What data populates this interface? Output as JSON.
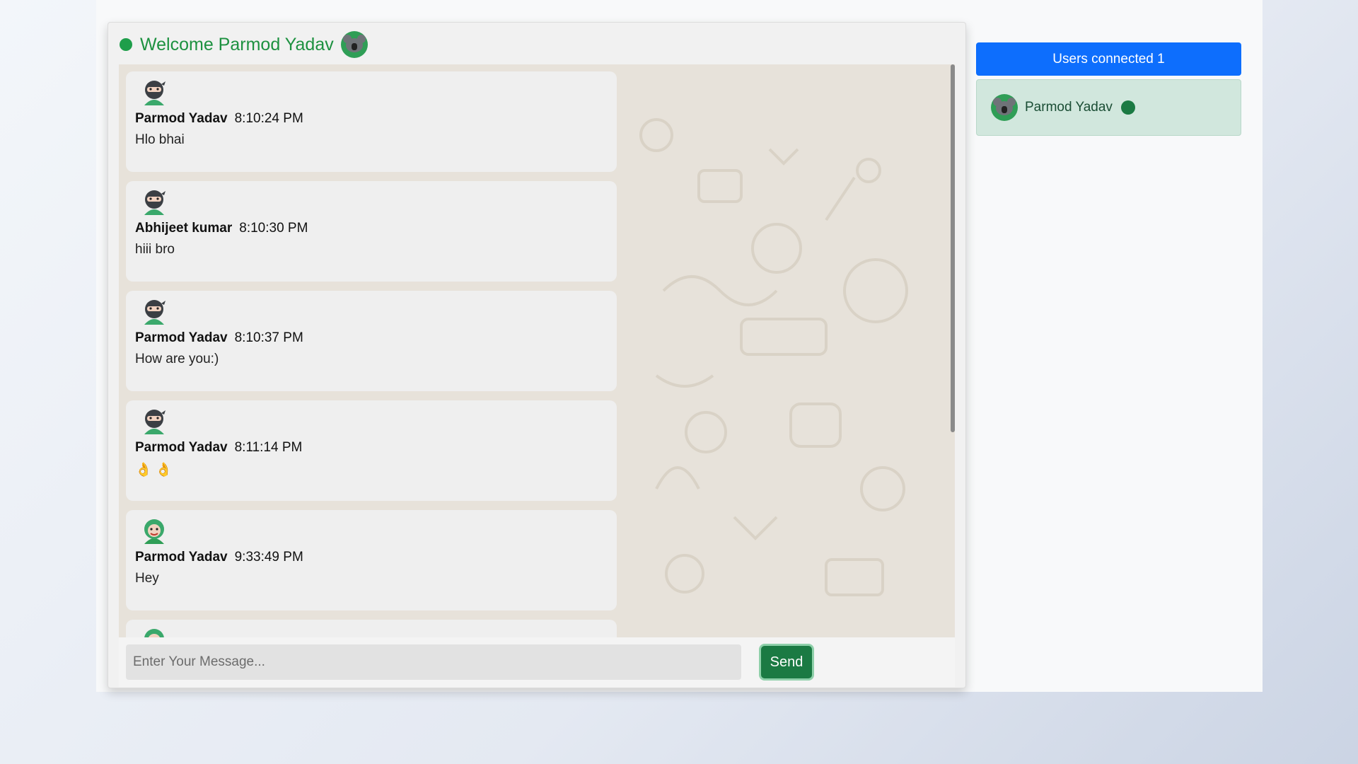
{
  "header": {
    "welcome_text": "Welcome Parmod Yadav"
  },
  "messages": [
    {
      "avatar": "ninja-avatar-icon",
      "name": "Parmod Yadav",
      "time": "8:10:24 PM",
      "text": "Hlo bhai"
    },
    {
      "avatar": "ninja-avatar-icon",
      "name": "Abhijeet kumar",
      "time": "8:10:30 PM",
      "text": "hiii bro"
    },
    {
      "avatar": "ninja-avatar-icon",
      "name": "Parmod Yadav",
      "time": "8:10:37 PM",
      "text": "How are you:)"
    },
    {
      "avatar": "ninja-avatar-icon",
      "name": "Parmod Yadav",
      "time": "8:11:14 PM",
      "text": "👌 👌"
    },
    {
      "avatar": "frog-avatar-icon",
      "name": "Parmod Yadav",
      "time": "9:33:49 PM",
      "text": "Hey"
    }
  ],
  "composer": {
    "placeholder": "Enter Your Message...",
    "send_label": "Send"
  },
  "users_panel": {
    "header": "Users connected 1",
    "users": [
      {
        "name": "Parmod Yadav",
        "status": "online"
      }
    ]
  },
  "colors": {
    "accent_green": "#1b7a43",
    "online_green": "#1e9e4a",
    "users_header_blue": "#0d6efd",
    "chat_background": "#e7e2da"
  }
}
